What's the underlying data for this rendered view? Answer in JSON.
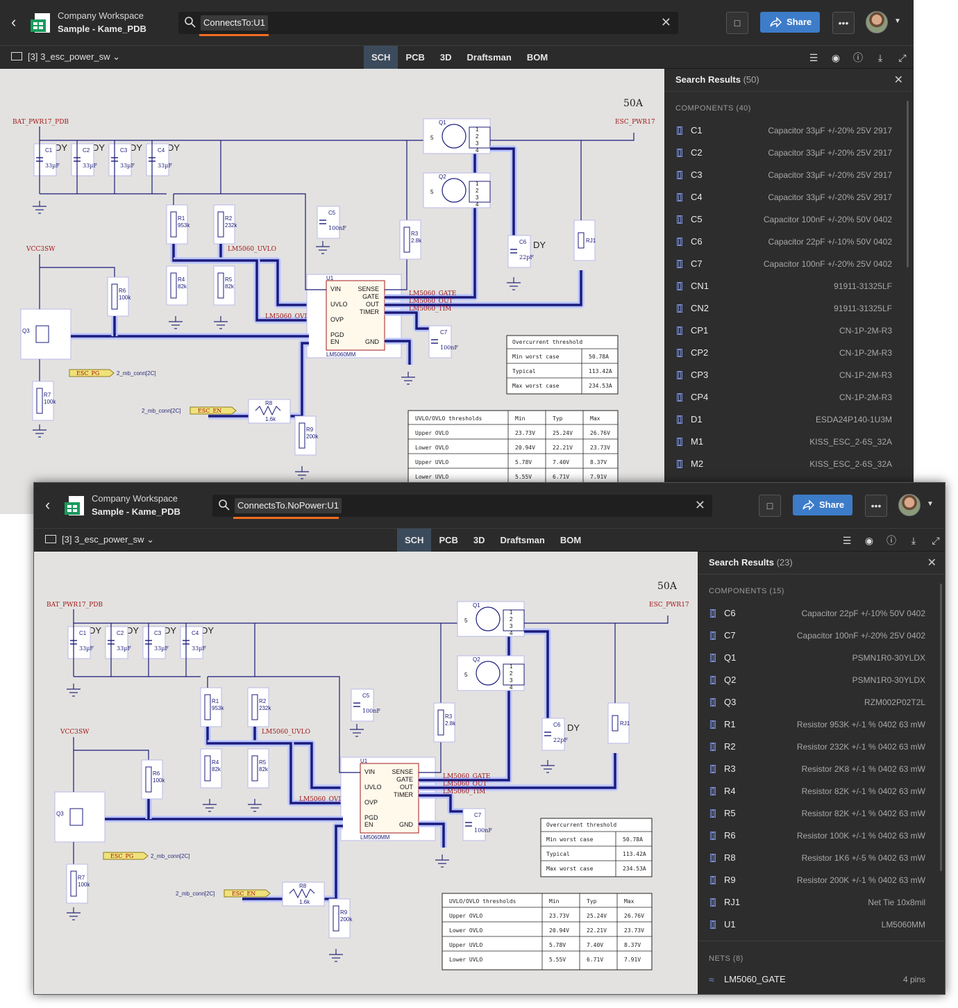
{
  "common": {
    "workspace": "Company Workspace",
    "project": "Sample - Kame_PDB",
    "share_label": "Share",
    "sheet": "[3] 3_esc_power_sw",
    "tabs": [
      "SCH",
      "PCB",
      "3D",
      "Draftsman",
      "BOM"
    ],
    "active_tab": "SCH",
    "panel_title": "Search Results",
    "components_label": "COMPONENTS",
    "nets_label": "NETS",
    "icons": [
      "back-icon",
      "app-icon",
      "search-icon",
      "close-icon",
      "comment-add-icon",
      "share-icon",
      "more-icon",
      "avatar",
      "chevron-down-icon",
      "sheet-icon",
      "comments-icon",
      "inspect-icon",
      "info-icon",
      "download-icon",
      "fullscreen-icon"
    ],
    "accent": "#f26d21",
    "share_color": "#3d7cc9"
  },
  "schematic": {
    "current_rating": "50A",
    "bat_net": "BAT_PWR17_PDB",
    "esc_net": "ESC_PWR17",
    "vcc_net": "VCC3SW",
    "dy": "DY",
    "caps": [
      {
        "ref": "C1",
        "val": "33µF"
      },
      {
        "ref": "C2",
        "val": "33µF"
      },
      {
        "ref": "C3",
        "val": "33µF"
      },
      {
        "ref": "C4",
        "val": "33µF"
      }
    ],
    "c5": {
      "ref": "C5",
      "val": "100nF"
    },
    "c6": {
      "ref": "C6",
      "val": "22pF"
    },
    "c7": {
      "ref": "C7",
      "val": "100nF"
    },
    "r1": {
      "ref": "R1",
      "val": "953k"
    },
    "r2": {
      "ref": "R2",
      "val": "232k"
    },
    "r3": {
      "ref": "R3",
      "val": "2.8k"
    },
    "r4": {
      "ref": "R4",
      "val": "82k"
    },
    "r5": {
      "ref": "R5",
      "val": "82k"
    },
    "r6": {
      "ref": "R6",
      "val": "100k"
    },
    "r7": {
      "ref": "R7",
      "val": "100k"
    },
    "r8": {
      "ref": "R8",
      "val": "1.6k"
    },
    "r9": {
      "ref": "R9",
      "val": "200k"
    },
    "rj1": "RJ1",
    "q1": "Q1",
    "q2": "Q2",
    "q3": "Q3",
    "u1": {
      "ref": "U1",
      "part": "LM5060MM",
      "pins_left": [
        "VIN",
        "UVLO",
        "OVP",
        "PGD",
        "EN"
      ],
      "pins_right": [
        "SENSE",
        "GATE",
        "OUT",
        "TIMER"
      ],
      "gnd": "GND"
    },
    "net_uvlo": "LM5060_UVLO",
    "net_ovlo": "LM5060_OVLO",
    "net_gate": "LM5060_GATE",
    "net_out": "LM5060_OUT",
    "net_tim": "LM5060_TIM",
    "esc_pg": "ESC_PG",
    "esc_en": "ESC_EN",
    "conn_ref": "2_mb_conn[2C]",
    "oc_table": {
      "title": "Overcurrent threshold",
      "rows": [
        [
          "Min worst case",
          "50.78A"
        ],
        [
          "Typical",
          "113.42A"
        ],
        [
          "Max worst case",
          "234.53A"
        ]
      ]
    },
    "uv_table": {
      "headers": [
        "UVLO/OVLO thresholds",
        "Min",
        "Typ",
        "Max"
      ],
      "rows": [
        [
          "Upper OVLO",
          "23.73V",
          "25.24V",
          "26.76V"
        ],
        [
          "Lower OVLO",
          "20.94V",
          "22.21V",
          "23.73V"
        ],
        [
          "Upper UVLO",
          "5.78V",
          "7.40V",
          "8.37V"
        ],
        [
          "Lower UVLO",
          "5.55V",
          "6.71V",
          "7.91V"
        ]
      ]
    }
  },
  "w1": {
    "query": "ConnectsTo:U1",
    "result_count": "(50)",
    "components_count": "(40)",
    "components": [
      {
        "name": "C1",
        "desc": "Capacitor 33µF +/-20% 25V 2917"
      },
      {
        "name": "C2",
        "desc": "Capacitor 33µF +/-20% 25V 2917"
      },
      {
        "name": "C3",
        "desc": "Capacitor 33µF +/-20% 25V 2917"
      },
      {
        "name": "C4",
        "desc": "Capacitor 33µF +/-20% 25V 2917"
      },
      {
        "name": "C5",
        "desc": "Capacitor 100nF +/-20% 50V 0402"
      },
      {
        "name": "C6",
        "desc": "Capacitor 22pF +/-10% 50V 0402"
      },
      {
        "name": "C7",
        "desc": "Capacitor 100nF +/-20% 25V 0402"
      },
      {
        "name": "CN1",
        "desc": "91911-31325LF"
      },
      {
        "name": "CN2",
        "desc": "91911-31325LF"
      },
      {
        "name": "CP1",
        "desc": "CN-1P-2M-R3"
      },
      {
        "name": "CP2",
        "desc": "CN-1P-2M-R3"
      },
      {
        "name": "CP3",
        "desc": "CN-1P-2M-R3"
      },
      {
        "name": "CP4",
        "desc": "CN-1P-2M-R3"
      },
      {
        "name": "D1",
        "desc": "ESDA24P140-1U3M"
      },
      {
        "name": "M1",
        "desc": "KISS_ESC_2-6S_32A"
      },
      {
        "name": "M2",
        "desc": "KISS_ESC_2-6S_32A"
      }
    ]
  },
  "w2": {
    "query": "ConnectsTo.NoPower:U1",
    "result_count": "(23)",
    "components_count": "(15)",
    "nets_count": "(8)",
    "components": [
      {
        "name": "C6",
        "desc": "Capacitor 22pF +/-10% 50V 0402"
      },
      {
        "name": "C7",
        "desc": "Capacitor 100nF +/-20% 25V 0402"
      },
      {
        "name": "Q1",
        "desc": "PSMN1R0-30YLDX"
      },
      {
        "name": "Q2",
        "desc": "PSMN1R0-30YLDX"
      },
      {
        "name": "Q3",
        "desc": "RZM002P02T2L"
      },
      {
        "name": "R1",
        "desc": "Resistor 953K +/-1 % 0402 63 mW"
      },
      {
        "name": "R2",
        "desc": "Resistor 232K +/-1 % 0402 63 mW"
      },
      {
        "name": "R3",
        "desc": "Resistor 2K8 +/-1 % 0402 63 mW"
      },
      {
        "name": "R4",
        "desc": "Resistor 82K +/-1 % 0402 63 mW"
      },
      {
        "name": "R5",
        "desc": "Resistor 82K +/-1 % 0402 63 mW"
      },
      {
        "name": "R6",
        "desc": "Resistor 100K +/-1 % 0402 63 mW"
      },
      {
        "name": "R8",
        "desc": "Resistor 1K6 +/-5 % 0402 63 mW"
      },
      {
        "name": "R9",
        "desc": "Resistor 200K +/-1 % 0402 63 mW"
      },
      {
        "name": "RJ1",
        "desc": "Net Tie 10x8mil"
      },
      {
        "name": "U1",
        "desc": "LM5060MM"
      }
    ],
    "nets": [
      {
        "name": "LM5060_GATE",
        "desc": "4 pins"
      }
    ]
  }
}
